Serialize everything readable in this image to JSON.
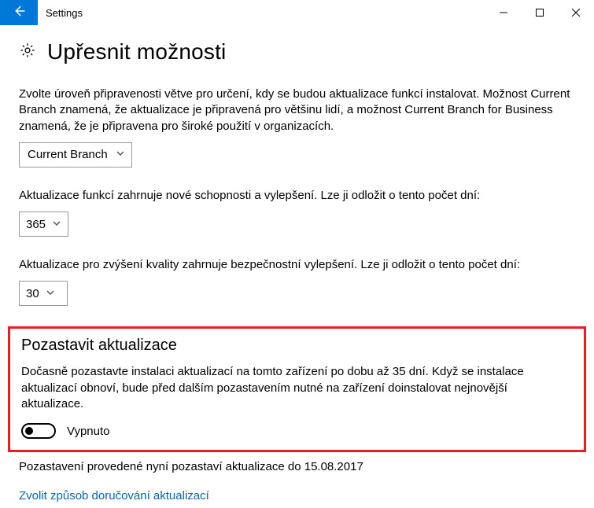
{
  "titlebar": {
    "title": "Settings"
  },
  "header": {
    "title": "Upřesnit možnosti"
  },
  "branch": {
    "description": "Zvolte úroveň připravenosti větve pro určení, kdy se budou aktualizace funkcí instalovat. Možnost Current Branch znamená, že aktualizace je připravená pro většinu lidí, a možnost Current Branch for Business znamená, že je připravena pro široké použití v organizacích.",
    "selected": "Current Branch"
  },
  "feature_defer": {
    "description": "Aktualizace funkcí zahrnuje nové schopnosti a vylepšení. Lze ji odložit o tento počet dní:",
    "value": "365"
  },
  "quality_defer": {
    "description": "Aktualizace pro zvýšení kvality zahrnuje bezpečnostní vylepšení. Lze ji odložit o tento počet dní:",
    "value": "30"
  },
  "pause": {
    "heading": "Pozastavit aktualizace",
    "description": "Dočasně pozastavte instalaci aktualizací na tomto zařízení po dobu až 35 dní. Když se instalace aktualizací obnoví, bude před dalším pozastavením nutné na zařízení doinstalovat nejnovější aktualizace.",
    "state_label": "Vypnuto",
    "footnote": "Pozastavení provedené nyní pozastaví aktualizace do 15.08.2017"
  },
  "delivery_link": "Zvolit způsob doručování aktualizací"
}
